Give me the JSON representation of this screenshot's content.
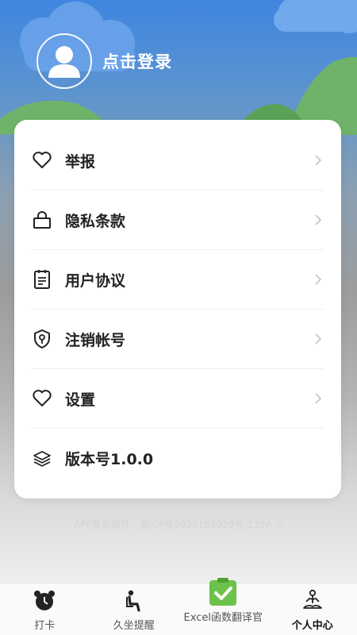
{
  "header": {
    "login_text": "点击登录"
  },
  "menu": {
    "items": [
      {
        "label": "举报",
        "icon": "heart-icon"
      },
      {
        "label": "隐私条款",
        "icon": "lock-icon"
      },
      {
        "label": "用户协议",
        "icon": "clipboard-icon"
      },
      {
        "label": "注销帐号",
        "icon": "shield-key-icon"
      },
      {
        "label": "设置",
        "icon": "heart-icon"
      },
      {
        "label": "版本号1.0.0",
        "icon": "layers-icon"
      }
    ]
  },
  "footer": {
    "icp": "APP备案编号：蜀ICP备2025163020号-133A >"
  },
  "tabbar": {
    "tabs": [
      {
        "label": "打卡",
        "icon": "alarm-clock-icon"
      },
      {
        "label": "久坐提醒",
        "icon": "sitting-person-icon"
      },
      {
        "label": "Excel函数翻译官",
        "icon": "checkbox-icon"
      },
      {
        "label": "个人中心",
        "icon": "meditation-icon",
        "active": true
      }
    ]
  },
  "colors": {
    "sky_top": "#3f86e0",
    "card_bg": "#ffffff",
    "check_green": "#6cc24a"
  }
}
